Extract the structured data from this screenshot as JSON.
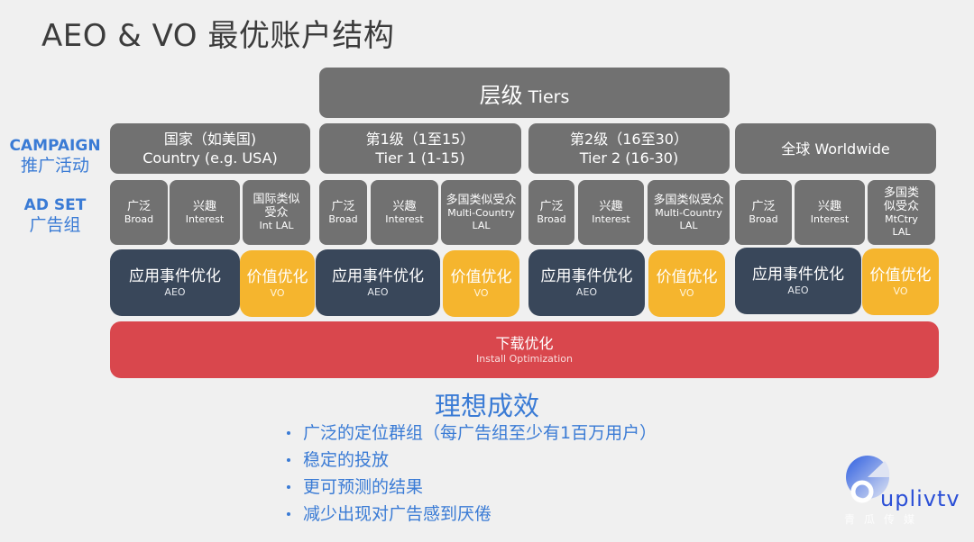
{
  "title": "AEO & VO 最优账户结构",
  "tiers_header": {
    "zh": "层级",
    "en": "Tiers"
  },
  "side_labels": {
    "campaign": {
      "en": "CAMPAIGN",
      "zh": "推广活动"
    },
    "adset": {
      "en": "AD SET",
      "zh": "广告组"
    }
  },
  "campaigns": [
    {
      "zh": "国家（如美国)",
      "en": "Country (e.g. USA)",
      "adsets": [
        {
          "zh": "广泛",
          "en": "Broad"
        },
        {
          "zh": "兴趣",
          "en": "Interest"
        },
        {
          "zh": "国际类似受众",
          "en": "Int LAL"
        }
      ],
      "aeo": {
        "zh": "应用事件优化",
        "en": "AEO"
      },
      "vo": {
        "zh": "价值优化",
        "en": "VO"
      }
    },
    {
      "zh": "第1级（1至15）",
      "en": "Tier 1 (1-15)",
      "adsets": [
        {
          "zh": "广泛",
          "en": "Broad"
        },
        {
          "zh": "兴趣",
          "en": "Interest"
        },
        {
          "zh": "多国类似受众",
          "en": "Multi-Country LAL"
        }
      ],
      "aeo": {
        "zh": "应用事件优化",
        "en": "AEO"
      },
      "vo": {
        "zh": "价值优化",
        "en": "VO"
      }
    },
    {
      "zh": "第2级（16至30）",
      "en": "Tier 2 (16-30)",
      "adsets": [
        {
          "zh": "广泛",
          "en": "Broad"
        },
        {
          "zh": "兴趣",
          "en": "Interest"
        },
        {
          "zh": "多国类似受众",
          "en": "Multi-Country LAL"
        }
      ],
      "aeo": {
        "zh": "应用事件优化",
        "en": "AEO"
      },
      "vo": {
        "zh": "价值优化",
        "en": "VO"
      }
    },
    {
      "zh": "全球 Worldwide",
      "en": "",
      "adsets": [
        {
          "zh": "广泛",
          "en": "Broad"
        },
        {
          "zh": "兴趣",
          "en": "Interest"
        },
        {
          "zh": "多国类似受众",
          "en": "MtCtry LAL"
        }
      ],
      "aeo": {
        "zh": "应用事件优化",
        "en": "AEO"
      },
      "vo": {
        "zh": "价值优化",
        "en": "VO"
      }
    }
  ],
  "install": {
    "zh": "下载优化",
    "en": "Install Optimization"
  },
  "results": {
    "title": "理想成效",
    "items": [
      "广泛的定位群组（每广告组至少有1百万用户）",
      "稳定的投放",
      "更可预测的结果",
      "减少出现对广告感到厌倦"
    ]
  },
  "logo": {
    "text": "uplivtv",
    "sub": "青瓜传媒"
  },
  "colors": {
    "gray_box": "#717171",
    "aeo": "#39475a",
    "vo": "#f5b52e",
    "install": "#d9474d",
    "accent_blue": "#3a7bd5",
    "background": "#f0f0f0"
  }
}
